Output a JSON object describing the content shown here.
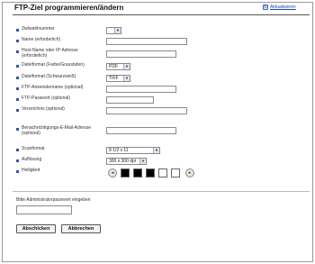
{
  "header": {
    "title": "FTP-Ziel programmieren/ändern",
    "refresh_label": "Aktualisieren"
  },
  "fields": {
    "zielwahlnummer": {
      "label": "Zielwahlnummer",
      "value": ""
    },
    "name": {
      "label": "Name (erforderlich)",
      "value": ""
    },
    "host": {
      "label": "Host-Name oder IP-Adresse (erforderlich)",
      "value": ""
    },
    "dateiformat_farbe": {
      "label": "Dateiformat (Farbe/Graustufen)",
      "value": "PDF"
    },
    "dateiformat_sw": {
      "label": "Dateiformat (Schwarzweiß)",
      "value": "TIFF"
    },
    "ftp_user": {
      "label": "FTP-Anwendername (optional)",
      "value": ""
    },
    "ftp_password": {
      "label": "FTP-Passwort (optional)",
      "value": ""
    },
    "verzeichnis": {
      "label": "Verzeichnis (optional)",
      "value": ""
    },
    "email": {
      "label": "Benachrichtigungs-E-Mail-Adresse (optional)",
      "value": ""
    },
    "scanformat": {
      "label": "Scanformat",
      "value": "8 1/2 x 11"
    },
    "aufloesung": {
      "label": "Auflösung",
      "value": "300 x 300 dpi"
    },
    "helligkeit": {
      "label": "Helligkeit",
      "level": 0.5
    }
  },
  "admin": {
    "password_label": "Bitte Administratorpasswort eingeben",
    "password_value": ""
  },
  "buttons": {
    "submit": "Abschicken",
    "cancel": "Abbrechen"
  },
  "colors": {
    "bullet": "#3355aa",
    "brightness_swatches": [
      "#000000",
      "#000000",
      "#000000",
      "#ffffff",
      "#ffffff"
    ]
  }
}
